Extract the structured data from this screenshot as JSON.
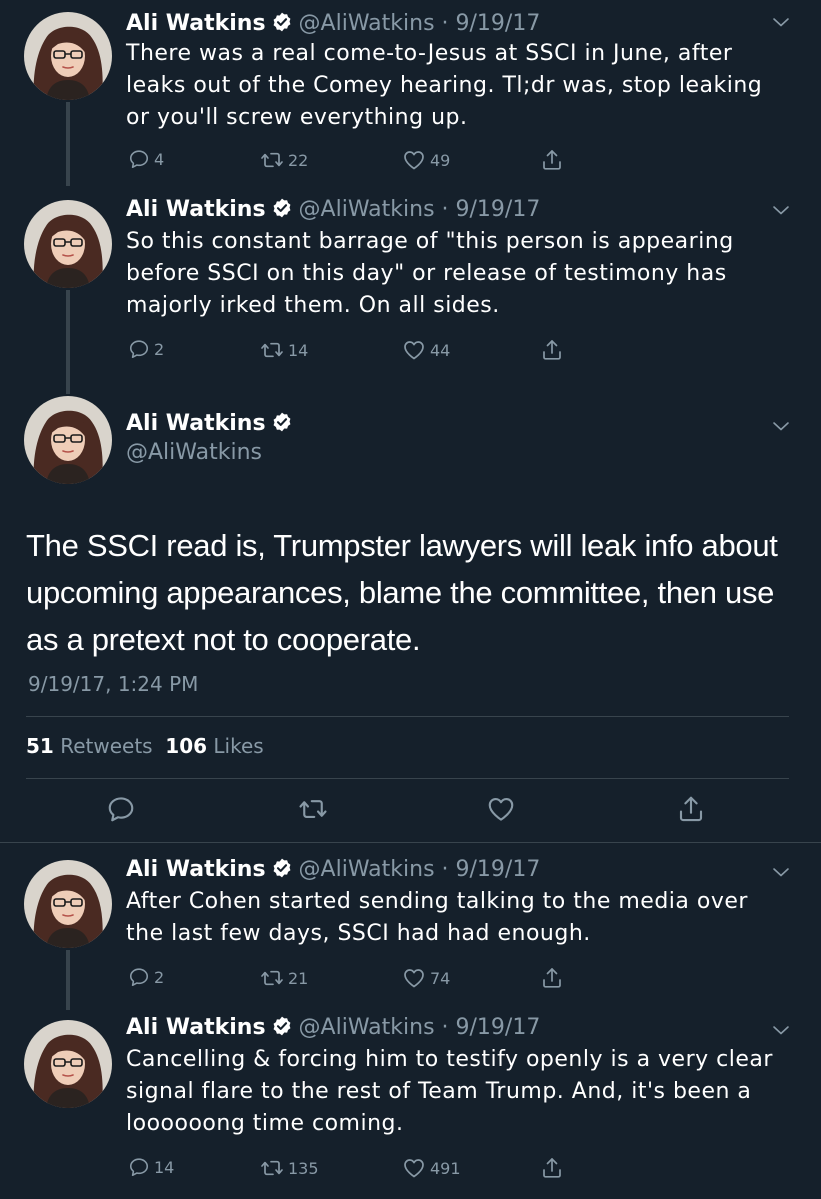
{
  "author": {
    "name": "Ali Watkins",
    "handle": "@AliWatkins"
  },
  "tweets_before": [
    {
      "meta": "@AliWatkins · 9/19/17",
      "text": "There was a real come-to-Jesus at SSCI in June, after leaks out of the Comey hearing. Tl;dr was, stop leaking or you'll screw everything up.",
      "replies": "4",
      "retweets": "22",
      "likes": "49"
    },
    {
      "meta": "@AliWatkins · 9/19/17",
      "text": "So this constant barrage of \"this person is appearing before SSCI on this day\" or release of testimony has majorly irked them. On all sides.",
      "replies": "2",
      "retweets": "14",
      "likes": "44"
    }
  ],
  "main_tweet": {
    "text": "The SSCI read is, Trumpster lawyers will leak info about upcoming appearances, blame the committee, then use as a pretext not to cooperate.",
    "timestamp": "9/19/17, 1:24 PM",
    "retweet_count": "51",
    "retweet_label": "Retweets",
    "like_count": "106",
    "like_label": "Likes"
  },
  "tweets_after": [
    {
      "meta": "@AliWatkins · 9/19/17",
      "text": "After Cohen started sending talking to the media over the last few days, SSCI had had enough.",
      "replies": "2",
      "retweets": "21",
      "likes": "74"
    },
    {
      "meta": "@AliWatkins · 9/19/17",
      "text": "Cancelling & forcing him to testify openly is a very clear signal flare to the rest of Team Trump. And, it's been a loooooong time coming.",
      "replies": "14",
      "retweets": "135",
      "likes": "491"
    }
  ],
  "icons": {
    "reply": "reply-icon",
    "retweet": "retweet-icon",
    "like": "heart-icon",
    "share": "share-icon",
    "verified": "verified-badge-icon",
    "caret": "chevron-down-icon"
  },
  "colors": {
    "background": "#15202b",
    "text": "#ffffff",
    "muted": "#8899a6",
    "divider": "#38444d"
  }
}
